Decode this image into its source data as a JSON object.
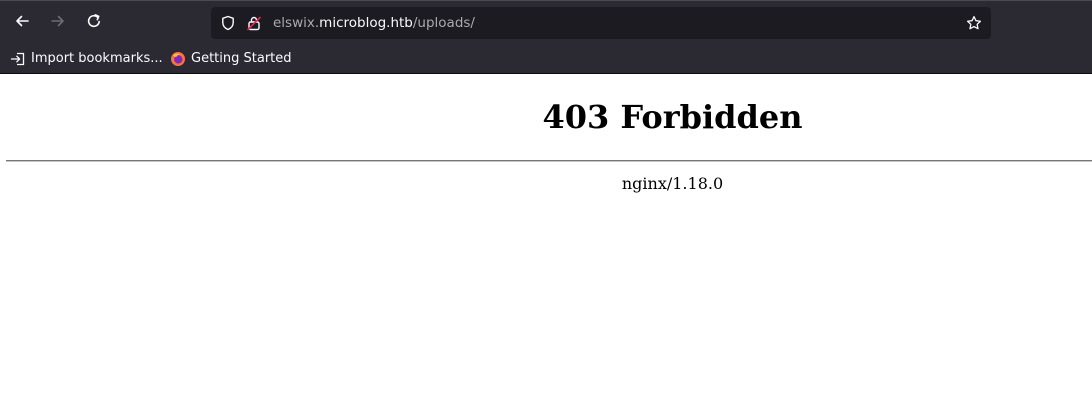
{
  "toolbar": {
    "back_icon": "back-arrow-icon",
    "forward_icon": "forward-arrow-icon",
    "reload_icon": "reload-icon"
  },
  "urlbar": {
    "url_prefix": "elswix.",
    "url_host": "microblog.htb",
    "url_path": "/uploads/",
    "shield_icon": "shield-icon",
    "lock_icon": "insecure-lock-icon",
    "star_icon": "bookmark-star-icon"
  },
  "bookmarks": {
    "items": [
      {
        "label": "Import bookmarks...",
        "icon": "import-icon"
      },
      {
        "label": "Getting Started",
        "icon": "firefox-icon"
      }
    ]
  },
  "page": {
    "title": "403 Forbidden",
    "server": "nginx/1.18.0"
  },
  "colors": {
    "chrome_bg": "#2b2a33",
    "urlbar_bg": "#1c1b22",
    "chrome_text": "#fbfbfe",
    "page_bg": "#ffffff"
  }
}
